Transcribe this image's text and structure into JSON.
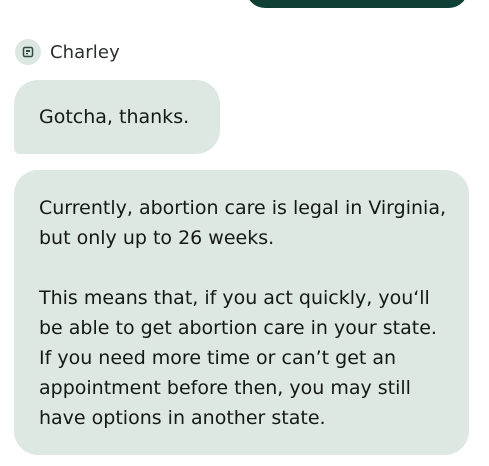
{
  "conversation": {
    "sender": {
      "name": "Charley",
      "avatar_icon": "chat-bot-icon"
    },
    "messages": [
      {
        "paragraphs": [
          "Gotcha, thanks."
        ]
      },
      {
        "paragraphs": [
          "Currently, abortion care is legal in Virginia, but only up to 26 weeks.",
          "This means that, if you act quickly, you‘ll be able to get abortion care in your state. If you need more time or can’t get an appointment before then, you may still have options in another state."
        ]
      }
    ]
  },
  "colors": {
    "bubble_background": "#dde8e2",
    "outgoing_bubble": "#0f3f35",
    "avatar_background": "#dce7e1",
    "text": "#141816"
  }
}
